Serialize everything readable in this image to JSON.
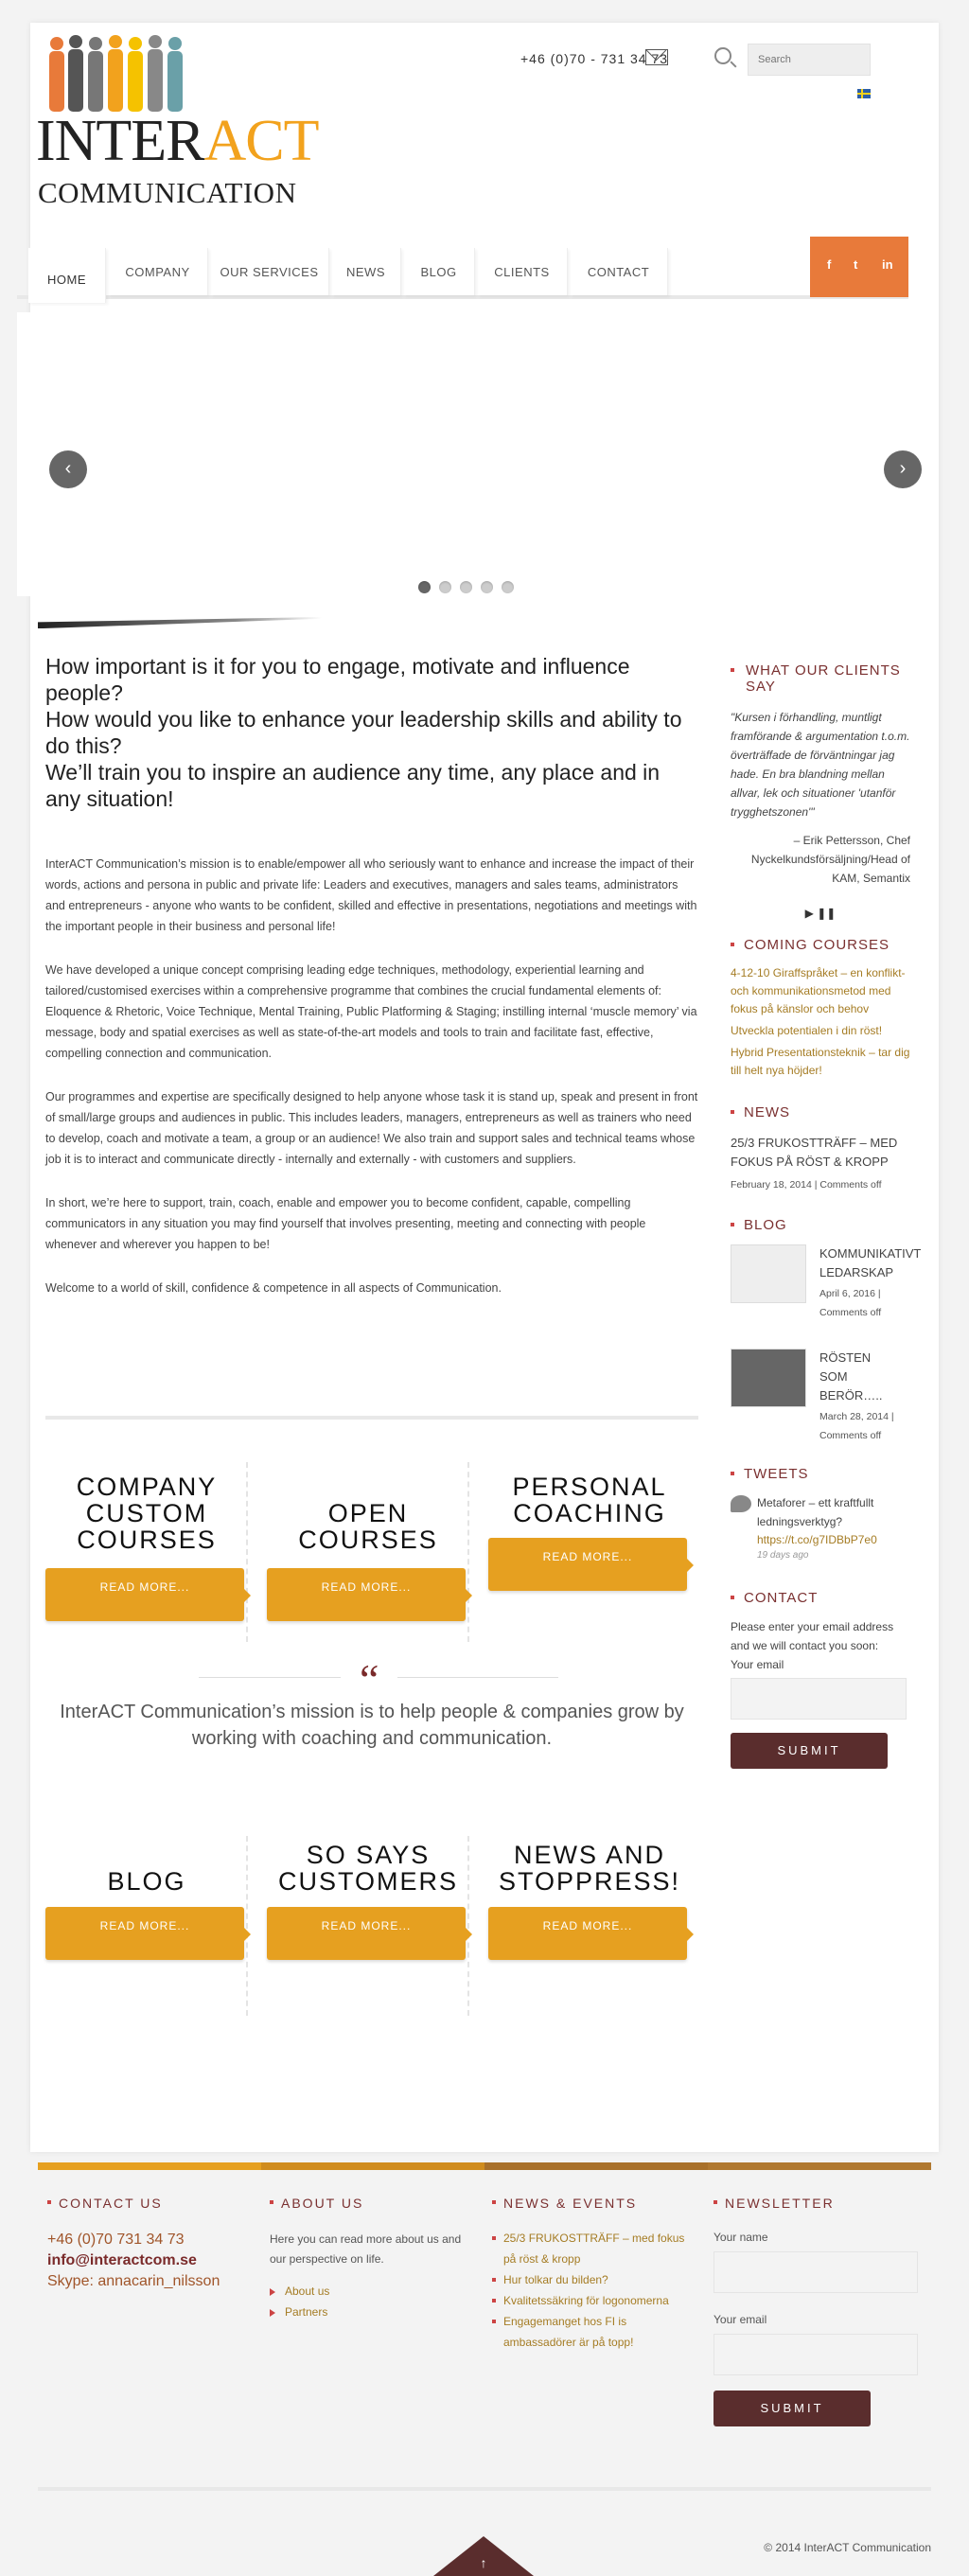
{
  "header": {
    "logo_line1_a": "INTER",
    "logo_line1_b": "ACT",
    "logo_line2": "COMMUNICATION",
    "phone": "+46 (0)70 - 731 34 73",
    "search_placeholder": "Search"
  },
  "nav": {
    "items": [
      "Home",
      "Company",
      "Our Services",
      "News",
      "Blog",
      "Clients",
      "Contact"
    ],
    "social": [
      "f",
      "t",
      "in"
    ]
  },
  "main": {
    "headline": "How important is it for you to engage, motivate and influence people?\nHow would you like to enhance your leadership skills and ability to do this?\nWe’ll train you to inspire an audience any time, any place and in any situation!",
    "paragraphs": [
      "InterACT Communication’s mission is to enable/empower all who seriously want to enhance and increase the impact of their words, actions and persona in public and private life: Leaders and executives, managers and sales teams, administrators and entrepreneurs - anyone who wants to be confident, skilled and effective in presentations, negotiations and meetings with the important people in their business and personal life!",
      "We have developed a unique concept comprising leading edge techniques, methodology, experiential learning and tailored/customised exercises within a comprehensive programme that combines the crucial fundamental elements of: Eloquence & Rhetoric, Voice Technique, Mental Training, Public Platforming & Staging; instilling internal ‘muscle memory’ via message, body and spatial exercises as well as state-of-the-art models and tools to train and facilitate fast, effective, compelling connection and communication.",
      "Our programmes and expertise are specifically designed to help anyone whose task it is stand up, speak and present in front of small/large groups and audiences in public. This includes leaders, managers, entrepreneurs as well as trainers who need to develop, coach and motivate a team, a group or an audience! We also train and support sales and technical teams whose job it is to interact and communicate directly - internally and externally - with customers and suppliers.",
      "In short, we’re here to support, train, coach, enable and empower you to become confident, capable, compelling communicators in any situation you may find yourself that involves presenting, meeting and connecting with people whenever and wherever you happen to be!",
      "Welcome to a world of skill, confidence & competence in all aspects of Communication."
    ],
    "boxes_row1": [
      {
        "title": "Company custom courses",
        "button": "Read more..."
      },
      {
        "title": "Open courses",
        "button": "Read more..."
      },
      {
        "title": "Personal coaching",
        "button": "Read more..."
      }
    ],
    "quote_mark": "“",
    "mission": "InterACT Communication’s mission is to help people & companies grow by working with coaching and communication.",
    "boxes_row2": [
      {
        "title": "Blog",
        "button": "Read more..."
      },
      {
        "title": "So says customers",
        "button": "Read more..."
      },
      {
        "title": "News and stoppress!",
        "button": "Read more..."
      }
    ]
  },
  "sidebar": {
    "clients_heading": "What our clients say",
    "testimonial": "\"Kursen i förhandling, muntligt framförande & argumentation t.o.m. överträffade de förväntningar jag hade. En bra blandning mellan allvar, lek och situationer 'utanför trygghetszonen'\"",
    "testimonial_author": "– Erik Pettersson, Chef Nyckelkundsförsäljning/Head of KAM, Semantix",
    "player": "▶ ❚❚",
    "courses_heading": "Coming courses",
    "courses": [
      "4-12-10 Giraffspråket – en konflikt- och kommunikationsmetod med fokus på känslor och behov",
      "Utveckla potentialen i din röst!",
      "Hybrid Presentationsteknik – tar dig till helt nya höjder!"
    ],
    "news_heading": "News",
    "news_title": "25/3 FRUKOSTTRÄFF – MED FOKUS PÅ RÖST & KROPP",
    "news_meta": "February 18, 2014 | Comments off",
    "blog_heading": "Blog",
    "blog_posts": [
      {
        "title": "KOMMUNIKATIVT LEDARSKAP",
        "meta": "April 6, 2016 | Comments off"
      },
      {
        "title": "RÖSTEN SOM BERÖR…..",
        "meta": "March 28, 2014 | Comments off"
      }
    ],
    "tweets_heading": "Tweets",
    "tweet_text": "Metaforer – ett kraftfullt ledningsverktyg?",
    "tweet_link": "https://t.co/g7IDBbP7e0",
    "tweet_time": "19 days ago",
    "contact_heading": "Contact",
    "contact_text": "Please enter your email address and we will contact you soon:",
    "email_label": "Your email",
    "submit": "Submit"
  },
  "footer": {
    "bar_colors": [
      "#e6a020",
      "#d08c1e",
      "#a8702a",
      "#b07830"
    ],
    "contact_heading": "Contact us",
    "phone": "+46 (0)70 731 34 73",
    "email": "info@interactcom.se",
    "skype": "Skype: annacarin_nilsson",
    "about_heading": "About us",
    "about_text": "Here you can read more about us and our perspective on life.",
    "about_links": [
      "About us",
      "Partners"
    ],
    "news_heading": "News & Events",
    "news_links": [
      "25/3 FRUKOSTTRÄFF – med fokus på röst & kropp",
      "Hur tolkar du bilden?",
      "Kvalitetssäkring för logonomerna",
      "Engagemanget hos FI is ambassadörer är på topp!"
    ],
    "newsletter_heading": "Newsletter",
    "name_label": "Your name",
    "email_label": "Your email",
    "submit": "Submit",
    "copyright": "© 2014 InterACT Communication",
    "to_top": "↑"
  },
  "colors": {
    "accent": "#e6a020",
    "brand_dark": "#5a2d2d",
    "social_bg": "#e87a3a"
  }
}
